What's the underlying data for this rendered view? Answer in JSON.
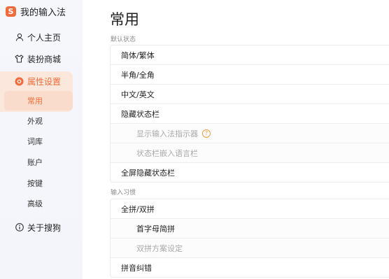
{
  "app": {
    "title": "我的输入法",
    "logo_letter": "S"
  },
  "sidebar": {
    "items": [
      {
        "label": "个人主页",
        "icon": "user-icon"
      },
      {
        "label": "装扮商城",
        "icon": "shirt-icon"
      },
      {
        "label": "属性设置",
        "icon": "settings-icon"
      },
      {
        "label": "关于搜狗",
        "icon": "info-icon"
      }
    ],
    "sub_items": [
      {
        "label": "常用"
      },
      {
        "label": "外观"
      },
      {
        "label": "词库"
      },
      {
        "label": "账户"
      },
      {
        "label": "按键"
      },
      {
        "label": "高级"
      }
    ]
  },
  "main": {
    "title": "常用",
    "sections": [
      {
        "label": "默认状态",
        "rows": [
          {
            "label": "简体/繁体"
          },
          {
            "label": "半角/全角"
          },
          {
            "label": "中文/英文"
          },
          {
            "label": "隐藏状态栏"
          },
          {
            "label": "显示输入法指示器",
            "help": "?"
          },
          {
            "label": "状态栏嵌入语言栏"
          },
          {
            "label": "全屏隐藏状态栏"
          }
        ]
      },
      {
        "label": "输入习惯",
        "rows": [
          {
            "label": "全拼/双拼"
          },
          {
            "label": "首字母简拼"
          },
          {
            "label": "双拼方案设定"
          },
          {
            "label": "拼音纠错"
          }
        ]
      }
    ]
  },
  "colors": {
    "accent": "#f26b3a",
    "sidebar_bg": "#f5f6fb",
    "active_bg": "#fbe7dc",
    "help": "#f0a040"
  }
}
